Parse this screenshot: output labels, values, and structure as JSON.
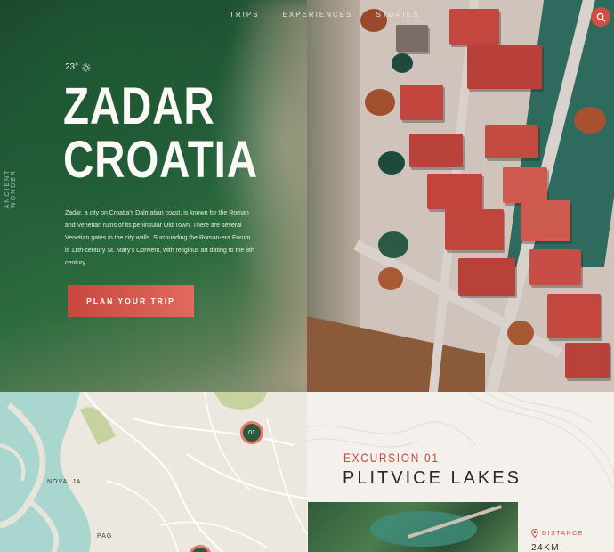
{
  "nav": {
    "items": [
      {
        "label": "TRIPS"
      },
      {
        "label": "EXPERIENCES"
      },
      {
        "label": "STORIES"
      }
    ]
  },
  "hero": {
    "side_label": "ANCIENT WONDER",
    "temperature": "23°",
    "title_line1": "ZADAR",
    "title_line2": "CROATIA",
    "description": "Zadar, a city on Croatia's Dalmatian coast, is known for the Roman and Venetian ruins of its peninsular Old Town. There are several Venetian gates in the city walls. Surrounding the Roman-era Forum is 11th-century St. Mary's Convent, with religious art dating to the 8th century.",
    "cta_label": "PLAN YOUR TRIP"
  },
  "map": {
    "places": [
      {
        "label": "NOVALJA"
      },
      {
        "label": "PAG"
      }
    ],
    "marker_label": "01"
  },
  "excursion": {
    "number": "EXCURSION 01",
    "name": "PLITVICE LAKES",
    "distance_label": "DISTANCE",
    "distance_value": "24KM"
  },
  "colors": {
    "accent": "#c9473e",
    "forest": "#2e5a3c",
    "sea": "#a9d6cf"
  },
  "icons": [
    "search-icon",
    "sun-icon",
    "map-pin-icon"
  ]
}
